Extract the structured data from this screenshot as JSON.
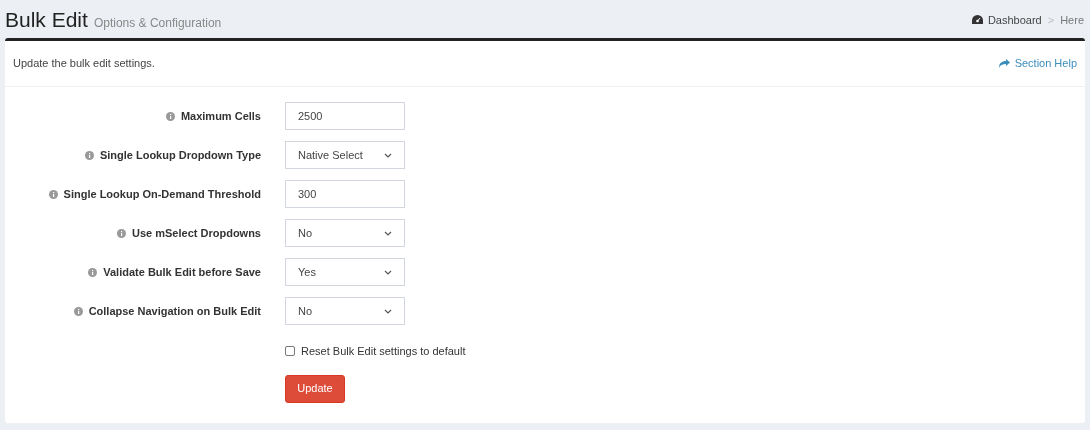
{
  "header": {
    "title": "Bulk Edit",
    "subtitle": "Options & Configuration"
  },
  "breadcrumb": [
    {
      "label": "Dashboard",
      "kind": "link"
    },
    {
      "label": "Here",
      "kind": "current"
    }
  ],
  "separator": ">",
  "box": {
    "description": "Update the bulk edit settings.",
    "help_link": "Section Help"
  },
  "fields": [
    {
      "label": "Maximum Cells",
      "kind": "text",
      "value": "2500"
    },
    {
      "label": "Single Lookup Dropdown Type",
      "kind": "select",
      "value": "Native Select"
    },
    {
      "label": "Single Lookup On-Demand Threshold",
      "kind": "text",
      "value": "300"
    },
    {
      "label": "Use mSelect Dropdowns",
      "kind": "select",
      "value": "No"
    },
    {
      "label": "Validate Bulk Edit before Save",
      "kind": "select",
      "value": "Yes"
    },
    {
      "label": "Collapse Navigation on Bulk Edit",
      "kind": "select",
      "value": "No"
    }
  ],
  "reset": {
    "label": "Reset Bulk Edit settings to default",
    "checked": false
  },
  "submit": "Update"
}
